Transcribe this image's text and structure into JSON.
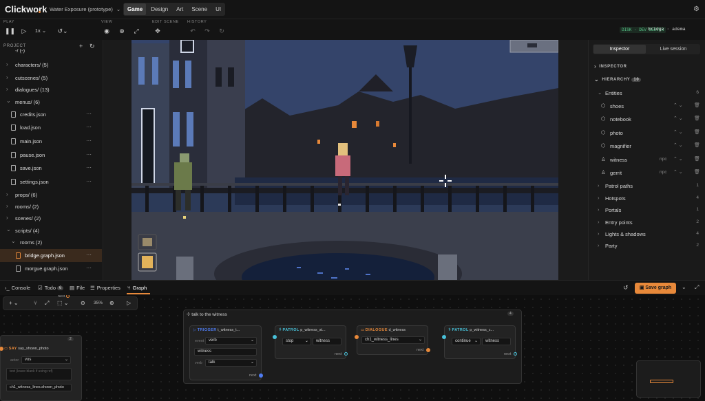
{
  "app": {
    "name": "Clickwork",
    "project": "Water Exposure (prototype)"
  },
  "modes": [
    "Game",
    "Design",
    "Art",
    "Scene",
    "UI"
  ],
  "toolbar": {
    "sections": {
      "play": "PLAY",
      "view": "VIEW",
      "edit_scene": "EDIT SCENE",
      "history": "HISTORY"
    },
    "speed": "1x",
    "server": "DISK · DEV SERVER",
    "branch": "bridge · adema"
  },
  "project": {
    "title": "PROJECT",
    "partial_row": "-/ (-)",
    "items": [
      {
        "label": "characters/ (5)"
      },
      {
        "label": "cutscenes/ (5)"
      },
      {
        "label": "dialogues/ (13)"
      },
      {
        "label": "menus/ (6)"
      },
      {
        "label": "credits.json"
      },
      {
        "label": "load.json"
      },
      {
        "label": "main.json"
      },
      {
        "label": "pause.json"
      },
      {
        "label": "save.json"
      },
      {
        "label": "settings.json"
      },
      {
        "label": "props/ (6)"
      },
      {
        "label": "rooms/ (2)"
      },
      {
        "label": "scenes/ (2)"
      },
      {
        "label": "scripts/ (4)"
      },
      {
        "label": "rooms (2)"
      },
      {
        "label": "bridge.graph.json"
      },
      {
        "label": "morgue.graph.json"
      }
    ]
  },
  "inspector": {
    "tabs": [
      "Inspector",
      "Live session"
    ],
    "inspector_label": "INSPECTOR",
    "hierarchy_label": "HIERARCHY",
    "hierarchy_count": "10",
    "entities": {
      "label": "Entities",
      "count": "6"
    },
    "entity_items": [
      {
        "label": "shoes",
        "tag": ""
      },
      {
        "label": "notebook",
        "tag": ""
      },
      {
        "label": "photo",
        "tag": ""
      },
      {
        "label": "magnifier",
        "tag": ""
      },
      {
        "label": "witness",
        "tag": "npc"
      },
      {
        "label": "gerrit",
        "tag": "npc"
      }
    ],
    "groups": [
      {
        "label": "Patrol paths",
        "count": "1"
      },
      {
        "label": "Hotspots",
        "count": "4"
      },
      {
        "label": "Portals",
        "count": "1"
      },
      {
        "label": "Entry points",
        "count": "2"
      },
      {
        "label": "Lights & shadows",
        "count": "4"
      },
      {
        "label": "Party",
        "count": "2"
      }
    ]
  },
  "bottom_tabs": {
    "console": "Console",
    "todo": "Todo",
    "todo_count": "6",
    "file": "File",
    "properties": "Properties",
    "graph": "Graph",
    "save": "Save graph"
  },
  "graph": {
    "zoom": "35%",
    "next_top": "next",
    "say_node": {
      "badge": "2",
      "kind": "SAY",
      "name": "say_shown_photo",
      "actor_label": "actor",
      "actor": "vos",
      "placeholder": "text (leave blank if using ref)",
      "ref": "ch1_witness_lines.shown_photo"
    },
    "group": {
      "title": "talk to the witness",
      "badge": "4"
    },
    "trigger": {
      "kind": "TRIGGER",
      "name": "t_witness_t...",
      "event_label": "event",
      "event": "verb",
      "target": "witness",
      "verb_label": "verb",
      "verb": "talk",
      "port": "next"
    },
    "patrol1": {
      "kind": "PATROL",
      "name": "p_witness_st...",
      "action": "stop",
      "target": "witness",
      "port": "next"
    },
    "dialogue": {
      "kind": "DIALOGUE",
      "name": "d_witness",
      "lines": "ch1_witness_lines",
      "port": "next"
    },
    "patrol2": {
      "kind": "PATROL",
      "name": "p_witness_c...",
      "action": "continue",
      "target": "witness",
      "port": "next"
    }
  },
  "colors": {
    "accent": "#e8893a",
    "blue": "#4f7cf2",
    "teal": "#48c0d8",
    "green": "#58c98b"
  }
}
